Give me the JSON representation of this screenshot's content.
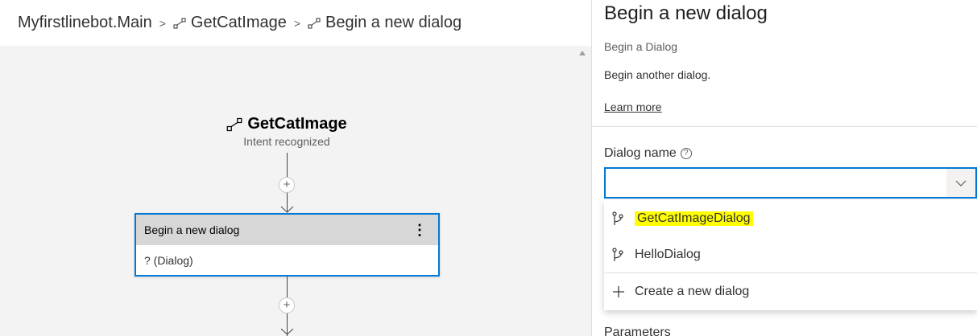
{
  "breadcrumb": {
    "items": [
      {
        "label": "Myfirstlinebot.Main"
      },
      {
        "label": "GetCatImage"
      },
      {
        "label": "Begin a new dialog"
      }
    ]
  },
  "canvas": {
    "trigger": {
      "title": "GetCatImage",
      "subtitle": "Intent recognized"
    },
    "action_card": {
      "title": "Begin a new dialog",
      "more_glyph": "⋮",
      "body": "? (Dialog)"
    },
    "add_glyph": "+"
  },
  "panel": {
    "title": "Begin a new dialog",
    "subtitle": "Begin a Dialog",
    "description": "Begin another dialog.",
    "learn_more": "Learn more",
    "dialog_name": {
      "label": "Dialog name",
      "help_glyph": "?",
      "value": "",
      "options": [
        {
          "label": "GetCatImageDialog",
          "icon": "branch-icon",
          "highlighted": true
        },
        {
          "label": "HelloDialog",
          "icon": "branch-icon",
          "highlighted": false
        },
        {
          "label": "Create a new dialog",
          "icon": "plus-icon",
          "highlighted": false
        }
      ]
    },
    "next_field_label_partial": "Parameters"
  },
  "colors": {
    "accent": "#0078d4",
    "highlight": "#ffff00",
    "canvas_bg": "#f3f3f3"
  }
}
